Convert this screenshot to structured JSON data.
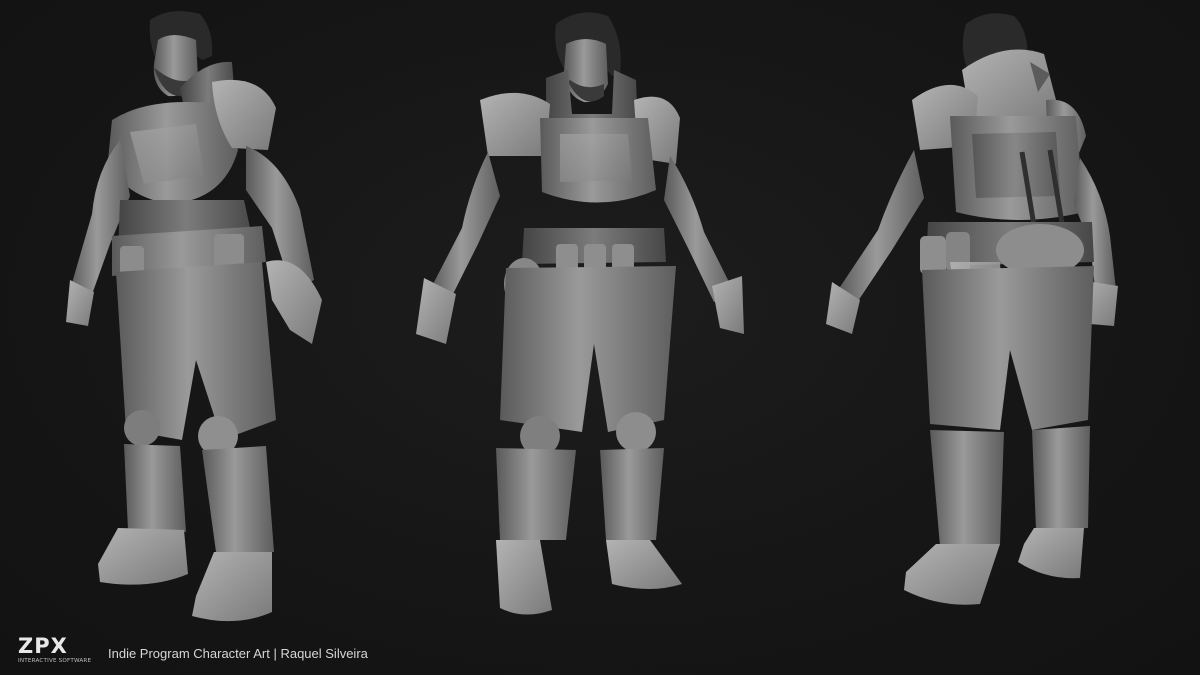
{
  "image": {
    "subject": "three-view character sculpt turnaround",
    "background_color": "#161616",
    "model_color": "#8a8a8a"
  },
  "branding": {
    "logo_text": "ZPX",
    "logo_tagline": "INTERACTIVE SOFTWARE",
    "caption": "Indie Program Character Art | Raquel Silveira"
  },
  "views": [
    "three-quarter-front-view",
    "front-view",
    "three-quarter-back-view"
  ]
}
